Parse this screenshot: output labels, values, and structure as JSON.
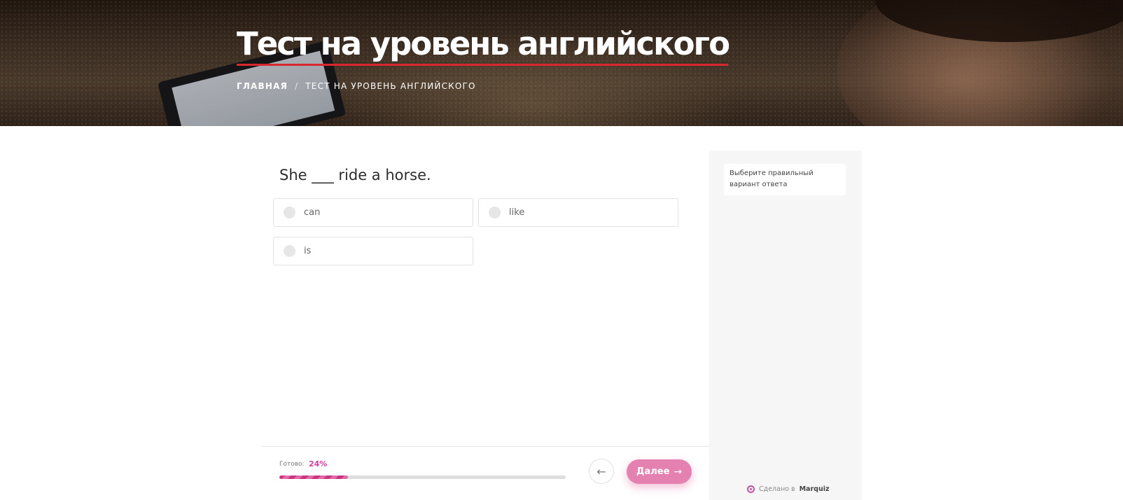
{
  "header": {
    "title": "Тест на уровень английского",
    "breadcrumb": [
      {
        "label": "ГЛАВНАЯ"
      },
      {
        "label": "ТЕСТ НА УРОВЕНЬ АНГЛИЙСКОГО"
      }
    ],
    "breadcrumb_separator": "/"
  },
  "quiz": {
    "question": "She ___ ride a horse.",
    "options": [
      {
        "label": "can",
        "selected": false
      },
      {
        "label": "like",
        "selected": false
      },
      {
        "label": "is",
        "selected": false
      }
    ]
  },
  "progress": {
    "label": "Готово:",
    "value_text": "24%",
    "value_fraction": 0.24
  },
  "navigation": {
    "back_icon": "arrow-left-icon",
    "next_label": "Далее",
    "next_icon": "arrow-right-icon"
  },
  "sidebar": {
    "hint": "Выберите правильный вариант ответа",
    "branding_prefix": "Сделано в",
    "branding_name": "Marquiz"
  },
  "colors": {
    "accent": "#e581b0",
    "progress_fill": "#c9357f",
    "title_underline": "#d8282f",
    "sidebar_bg": "#f6f6f6"
  }
}
